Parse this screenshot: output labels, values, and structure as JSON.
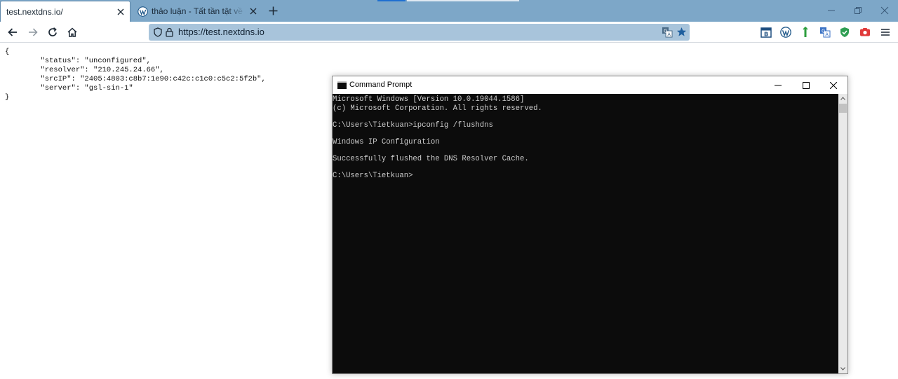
{
  "colors": {
    "tabstrip_bg": "#7da7c8",
    "urlbar_bg": "#a8c4db",
    "console_bg": "#0c0c0c",
    "console_text": "#cccccc"
  },
  "browser": {
    "tabs": [
      {
        "title": "test.nextdns.io/",
        "active": true
      },
      {
        "title": "thảo luận - Tất tần tật về dịch vụ",
        "active": false,
        "icon": "wordpress-icon"
      }
    ],
    "address": "https://test.nextdns.io"
  },
  "page": {
    "json_lines": [
      "{",
      "        \"status\": \"unconfigured\",",
      "        \"resolver\": \"210.245.24.66\",",
      "        \"srcIP\": \"2405:4803:c8b7:1e90:c42c:c1c0:c5c2:5f2b\",",
      "        \"server\": \"gsl-sin-1\"",
      "}"
    ]
  },
  "cmd": {
    "title": "Command Prompt",
    "lines": [
      "Microsoft Windows [Version 10.0.19044.1586]",
      "(c) Microsoft Corporation. All rights reserved.",
      "",
      "C:\\Users\\Tietkuan>ipconfig /flushdns",
      "",
      "Windows IP Configuration",
      "",
      "Successfully flushed the DNS Resolver Cache.",
      "",
      "C:\\Users\\Tietkuan>"
    ]
  }
}
